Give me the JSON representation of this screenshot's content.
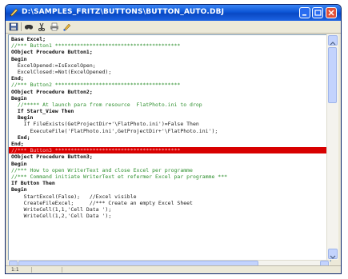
{
  "window": {
    "title": "D:\\SAMPLES_FRITZ\\BUTTONS\\BUTTON_AUTO.DBJ",
    "accent": "#0c55d6",
    "close_color": "#e0513a"
  },
  "toolbar": {
    "icons": [
      "save-icon",
      "find-icon",
      "cut-icon",
      "print-icon",
      "paint-icon"
    ]
  },
  "editor": {
    "highlight_color": "#d80000",
    "lines": [
      {
        "text": "Base Excel;",
        "style": "kw"
      },
      {
        "text": "//*** Button1 ****************************************",
        "style": "cm"
      },
      {
        "text": "OObject Procedure Button1;",
        "style": "kw"
      },
      {
        "text": "Begin",
        "style": "kw"
      },
      {
        "text": "  ExcelOpened:=IsExcelOpen;",
        "style": "code"
      },
      {
        "text": "  ExcelClosed:=Not(ExcelOpened);",
        "style": "code"
      },
      {
        "text": "End;",
        "style": "kw"
      },
      {
        "text": "//*** Button2 ****************************************",
        "style": "cm"
      },
      {
        "text": "OObject Procedure Button2;",
        "style": "kw"
      },
      {
        "text": "Begin",
        "style": "kw"
      },
      {
        "text": "  //***** At launch para from resource  FlatPhoto.ini to drop",
        "style": "cm"
      },
      {
        "text": "  If Start_View Then",
        "style": "kw"
      },
      {
        "text": "  Begin",
        "style": "kw"
      },
      {
        "text": "    If FileExists(GetProjectDir+'\\FlatPhoto.ini')=False Then",
        "style": "code"
      },
      {
        "text": "      ExecuteFile('FlatPhoto.ini',GetProjectDir+'\\FlatPhoto.ini');",
        "style": "code"
      },
      {
        "text": "  End;",
        "style": "kw"
      },
      {
        "text": "End;",
        "style": "kw"
      },
      {
        "text": "//*** Button3 ****************************************",
        "style": "hl"
      },
      {
        "text": "OObject Procedure Button3;",
        "style": "kw"
      },
      {
        "text": "Begin",
        "style": "kw"
      },
      {
        "text": "//*** How to open WriterText and close Excel per programme",
        "style": "cm"
      },
      {
        "text": "//*** Command initiate WriterText et refermer Excel par programme ***",
        "style": "cm"
      },
      {
        "text": "If Button Then",
        "style": "kw"
      },
      {
        "text": "Begin",
        "style": "kw"
      },
      {
        "text": "    StartExcel(False);   //Excel visible",
        "style": "code"
      },
      {
        "text": "    CreateFileExcel;     //*** Create an empty Excel Sheet",
        "style": "code"
      },
      {
        "text": "    WriteCell(1,1,'Cell Data ');",
        "style": "code"
      },
      {
        "text": "    WriteCell(1,2,'Cell Data ');",
        "style": "code"
      }
    ]
  },
  "statusbar": {
    "line": "1:1",
    "mode": ""
  }
}
